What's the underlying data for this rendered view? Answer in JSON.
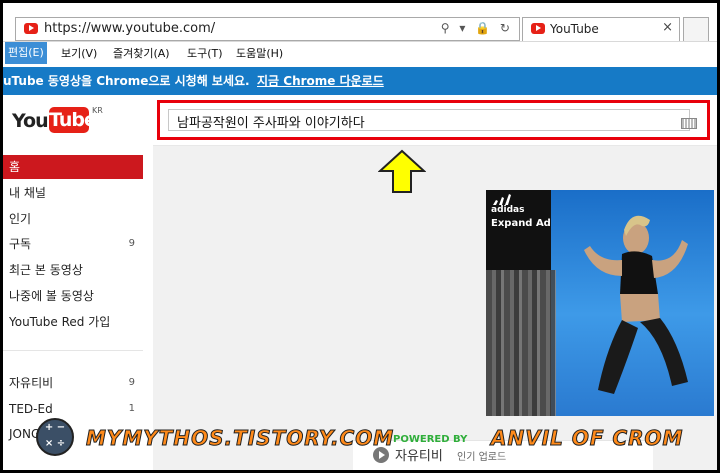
{
  "browser": {
    "url": "https://www.youtube.com/",
    "tab_title": "YouTube",
    "addr_icons": "⚲ ▾ 🔒 ↻",
    "tab_close": "×"
  },
  "menu": {
    "items": [
      "편집(E)",
      "보기(V)",
      "즐겨찾기(A)",
      "도구(T)",
      "도움말(H)"
    ]
  },
  "promo": {
    "message": "uTube 동영상을 Chrome으로 시청해 보세요.",
    "link": "지금 Chrome 다운로드"
  },
  "logo": {
    "you": "You",
    "tube": "Tube",
    "region": "KR"
  },
  "search": {
    "query": "남파공작원이 주사파와 이야기하다"
  },
  "sidebar": {
    "items": [
      {
        "label": "홈",
        "count": ""
      },
      {
        "label": "내 채널",
        "count": ""
      },
      {
        "label": "인기",
        "count": ""
      },
      {
        "label": "구독",
        "count": "9"
      },
      {
        "label": "최근 본 동영상",
        "count": ""
      },
      {
        "label": "나중에 볼 동영상",
        "count": ""
      },
      {
        "label": "YouTube Red 가입",
        "count": ""
      }
    ],
    "subscriptions": [
      {
        "label": "자유티비",
        "count": "9"
      },
      {
        "label": "TED-Ed",
        "count": "1"
      },
      {
        "label": "JONG",
        "count": ""
      }
    ]
  },
  "ad": {
    "brand": "adidas",
    "expand": "Expand Ad"
  },
  "bottom": {
    "title": "자유티비",
    "sub": "인기 업로드"
  },
  "watermark": {
    "site": "MYMYTHOS.TISTORY.COM",
    "powered": "POWERED BY",
    "author": "ANVIL OF CROM"
  },
  "colors": {
    "accent": "#e62117",
    "promo": "#167ac6",
    "highlight": "#e8000b",
    "arrow": "#ffff00"
  }
}
